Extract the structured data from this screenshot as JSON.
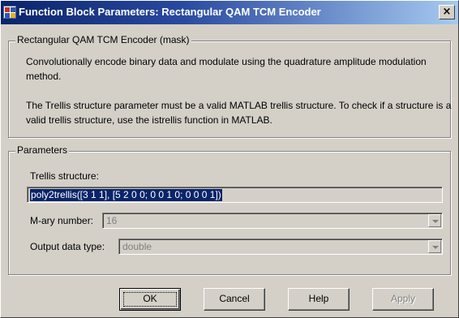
{
  "window": {
    "title": "Function Block Parameters: Rectangular QAM TCM Encoder",
    "close_glyph": "×",
    "icon": "simulink-block-icon"
  },
  "mask": {
    "group_label": "Rectangular QAM TCM Encoder (mask)",
    "description_1": "Convolutionally encode binary data and modulate using the quadrature amplitude modulation method.",
    "description_2": "The Trellis structure parameter must be a valid MATLAB trellis structure. To check if a structure is a valid trellis structure, use the istrellis function in MATLAB."
  },
  "parameters": {
    "group_label": "Parameters",
    "trellis_label": "Trellis structure:",
    "trellis_value": "poly2trellis([3 1 1], [5 2 0 0; 0 0 1 0; 0 0 0 1])",
    "mary_label": "M-ary number:",
    "mary_value": "16",
    "output_label": "Output data type:",
    "output_value": "double"
  },
  "buttons": {
    "ok": "OK",
    "cancel": "Cancel",
    "help": "Help",
    "apply": "Apply"
  },
  "colors": {
    "titlebar_start": "#0a246a",
    "titlebar_end": "#a6caf0",
    "face": "#d4d0c8",
    "selection": "#0a246a"
  }
}
